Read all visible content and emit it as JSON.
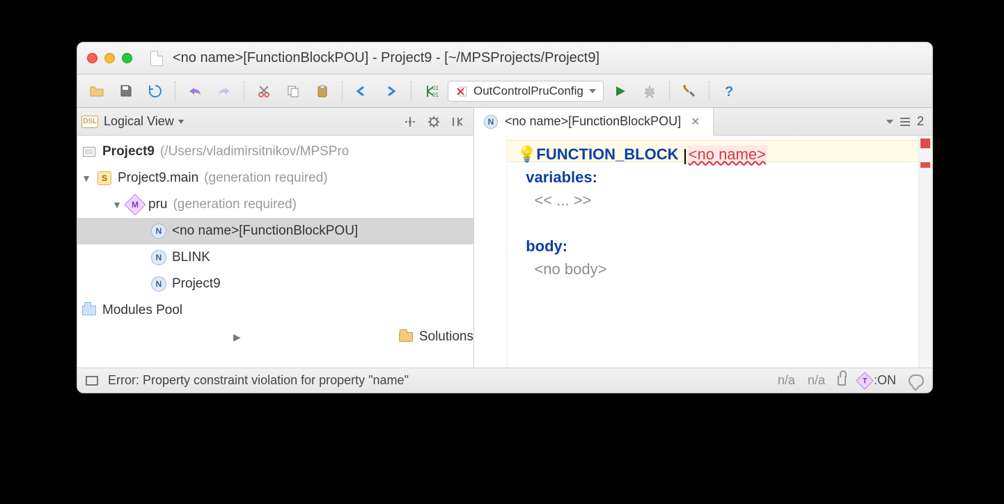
{
  "title": "<no name>[FunctionBlockPOU] - Project9 - [~/MPSProjects/Project9]",
  "toolbar": {
    "runConfig": "OutControlPruConfig"
  },
  "leftPanel": {
    "title": "Logical View",
    "root": {
      "name": "Project9",
      "path": "(/Users/vladimirsitnikov/MPSPro"
    },
    "main": {
      "name": "Project9.main",
      "note": "(generation required)"
    },
    "pru": {
      "name": "pru",
      "note": "(generation required)"
    },
    "nodes": {
      "n1": "<no name>[FunctionBlockPOU]",
      "n2": "BLINK",
      "n3": "Project9"
    },
    "modulesPool": "Modules Pool",
    "solutions": "Solutions"
  },
  "tabs": {
    "active": "<no name>[FunctionBlockPOU]",
    "count": "2"
  },
  "editor": {
    "functionBlock": "FUNCTION_BLOCK",
    "noName": "<no name>",
    "variables": "variables:",
    "placeholder": "<< ... >>",
    "body": "body:",
    "noBody": "<no body>"
  },
  "status": {
    "message": "Error: Property constraint violation for property \"name\"",
    "na1": "n/a",
    "na2": "n/a",
    "typesystem": ":ON"
  }
}
